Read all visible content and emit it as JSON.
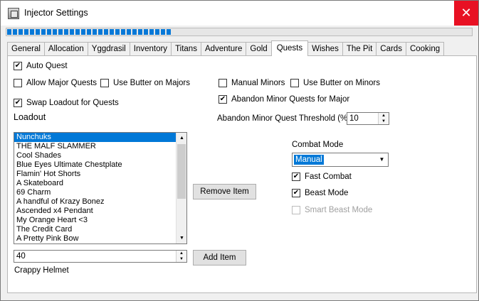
{
  "window": {
    "title": "Injector Settings",
    "close_symbol": "✕"
  },
  "progress": {
    "fraction": 0.355
  },
  "tabs": [
    {
      "label": "General"
    },
    {
      "label": "Allocation"
    },
    {
      "label": "Yggdrasil"
    },
    {
      "label": "Inventory"
    },
    {
      "label": "Titans"
    },
    {
      "label": "Adventure"
    },
    {
      "label": "Gold"
    },
    {
      "label": "Quests",
      "active": true
    },
    {
      "label": "Wishes"
    },
    {
      "label": "The Pit"
    },
    {
      "label": "Cards"
    },
    {
      "label": "Cooking"
    }
  ],
  "quests": {
    "auto_quest": {
      "label": "Auto Quest",
      "checked": true
    },
    "allow_major": {
      "label": "Allow Major Quests",
      "checked": false
    },
    "butter_major": {
      "label": "Use Butter on Majors",
      "checked": false
    },
    "manual_minors": {
      "label": "Manual Minors",
      "checked": false
    },
    "butter_minors": {
      "label": "Use Butter on Minors",
      "checked": false
    },
    "abandon_minor": {
      "label": "Abandon Minor Quests for Major",
      "checked": true
    },
    "swap_loadout": {
      "label": "Swap Loadout for Quests",
      "checked": true
    },
    "loadout_label": "Loadout",
    "threshold_label": "Abandon Minor Quest Threshold (%)",
    "threshold_value": "10",
    "loadout_items": [
      "Nunchuks",
      "THE MALF SLAMMER",
      "Cool Shades",
      "Blue Eyes Ultimate Chestplate",
      "Flamin' Hot Shorts",
      "A Skateboard",
      "69 Charm",
      "A handful of Krazy Bonez",
      "Ascended x4 Pendant",
      "My Orange Heart <3",
      "The Credit Card",
      "A Pretty Pink Bow"
    ],
    "selected_index": 0,
    "remove_button": "Remove Item",
    "add_value": "40",
    "add_button": "Add Item",
    "item_name": "Crappy Helmet",
    "combat_mode_label": "Combat Mode",
    "combat_mode_value": "Manual",
    "fast_combat": {
      "label": "Fast Combat",
      "checked": true
    },
    "beast_mode": {
      "label": "Beast Mode",
      "checked": true
    },
    "smart_beast": {
      "label": "Smart Beast Mode",
      "checked": false,
      "disabled": true
    }
  },
  "icons": {
    "check": "✔",
    "scroll_up": "▲",
    "scroll_down": "▼",
    "spin_up": "▲",
    "spin_down": "▼",
    "dropdown": "▼"
  }
}
